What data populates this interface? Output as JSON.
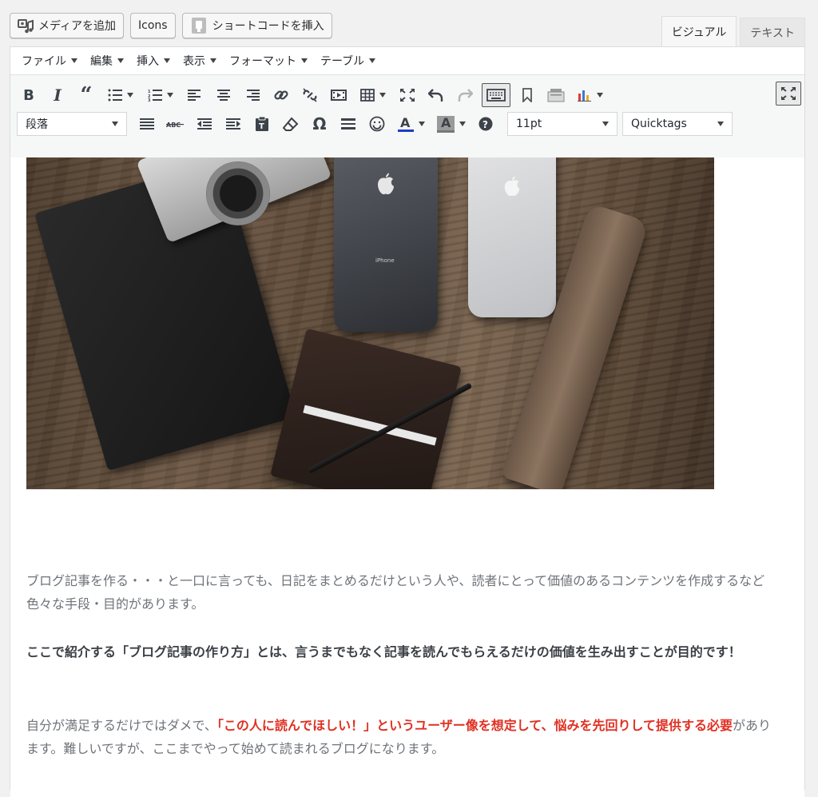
{
  "media_buttons": {
    "add_media": "メディアを追加",
    "icons": "Icons",
    "shortcode": "ショートコードを挿入"
  },
  "tabs": {
    "visual": "ビジュアル",
    "text": "テキスト"
  },
  "menubar": [
    "ファイル",
    "編集",
    "挿入",
    "表示",
    "フォーマット",
    "テーブル"
  ],
  "toolbar": {
    "format_select": "段落",
    "font_size_select": "11pt",
    "quicktags_select": "Quicktags"
  },
  "photo": {
    "phone_label": "iPhone"
  },
  "content": {
    "p1": "ブログ記事を作る・・・と一口に言っても、日記をまとめるだけという人や、読者にとって価値のあるコンテンツを作成するなど色々な手段・目的があります。",
    "p2": "ここで紹介する「ブログ記事の作り方」とは、言うまでもなく記事を読んでもらえるだけの価値を生み出すことが目的です！",
    "p3_before": "自分が満足するだけではダメで、",
    "p3_highlight": "「この人に読んでほしい！」というユーザー像を想定して、悩みを先回りして提供する必要",
    "p3_after": "があります。難しいですが、ここまでやって始めて読まれるブログになります。"
  },
  "colors": {
    "highlight_red": "#e03022",
    "font_color_underline": "#1e3ccc"
  }
}
